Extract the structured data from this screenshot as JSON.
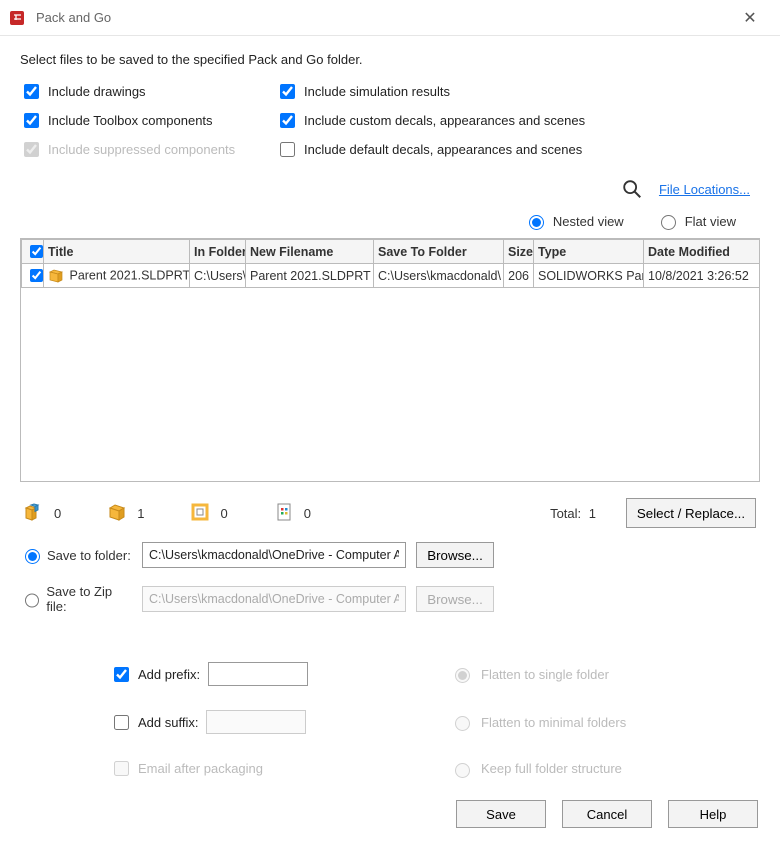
{
  "window": {
    "title": "Pack and Go"
  },
  "instruction": "Select files to be saved to the specified Pack and Go folder.",
  "options": {
    "include_drawings": "Include drawings",
    "include_simulation": "Include simulation results",
    "include_toolbox": "Include Toolbox components",
    "include_custom_decals": "Include custom decals, appearances and scenes",
    "include_suppressed": "Include suppressed components",
    "include_default_decals": "Include default decals, appearances and scenes"
  },
  "links": {
    "file_locations": "File Locations..."
  },
  "view": {
    "nested": "Nested view",
    "flat": "Flat view"
  },
  "table": {
    "headers": {
      "title": "Title",
      "in_folder": "In Folder",
      "new_filename": "New Filename",
      "save_to": "Save To Folder",
      "size": "Size",
      "type": "Type",
      "date_modified": "Date Modified"
    },
    "row": {
      "title": "Parent 2021.SLDPRT",
      "in_folder": "C:\\Users\\",
      "new_filename": "Parent 2021.SLDPRT",
      "save_to": "C:\\Users\\kmacdonald\\",
      "size": "206",
      "type": "SOLIDWORKS Part",
      "date_modified": "10/8/2021 3:26:52"
    }
  },
  "summary": {
    "assembly_count": "0",
    "part_count": "1",
    "drawing_count": "0",
    "other_count": "0",
    "total_label": "Total:",
    "total_value": "1",
    "select_replace": "Select / Replace..."
  },
  "dest": {
    "save_folder_label": "Save to folder:",
    "save_folder_value": "C:\\Users\\kmacdonald\\OneDrive - Computer Ai",
    "save_zip_label": "Save to Zip file:",
    "save_zip_value": "C:\\Users\\kmacdonald\\OneDrive - Computer Ai",
    "browse": "Browse..."
  },
  "extras": {
    "add_prefix": "Add prefix:",
    "add_suffix": "Add suffix:",
    "email_after": "Email after packaging",
    "flatten_single": "Flatten to single folder",
    "flatten_minimal": "Flatten to minimal folders",
    "keep_full": "Keep full folder structure"
  },
  "footer": {
    "save": "Save",
    "cancel": "Cancel",
    "help": "Help"
  }
}
